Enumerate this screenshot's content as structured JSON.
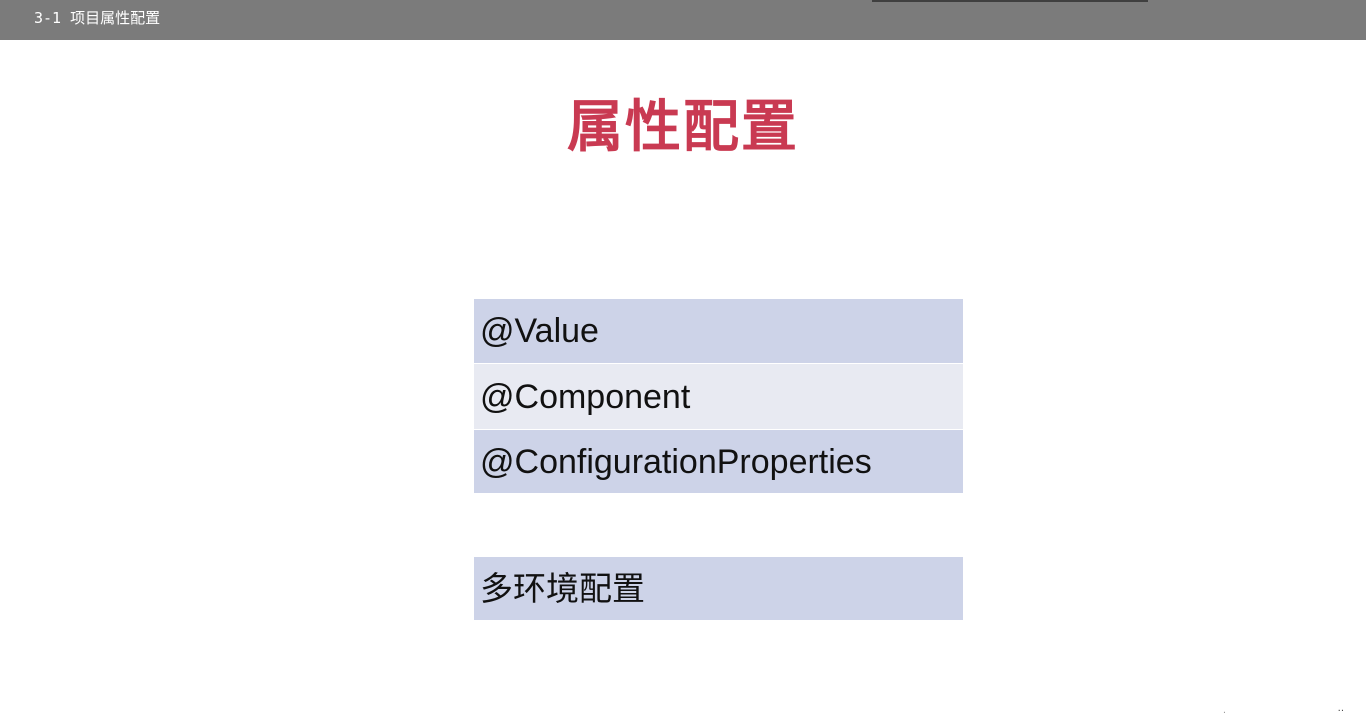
{
  "header": {
    "title": "3-1 项目属性配置"
  },
  "slide": {
    "title": "属性配置",
    "table": {
      "rows": [
        "@Value",
        "@Component",
        "@ConfigurationProperties"
      ]
    },
    "table2": {
      "rows": [
        "多环境配置"
      ]
    }
  },
  "colors": {
    "topbar": "#7b7b7b",
    "title": "#c93a52",
    "row_dark": "#cdd3e8",
    "row_light": "#e8eaf2"
  }
}
